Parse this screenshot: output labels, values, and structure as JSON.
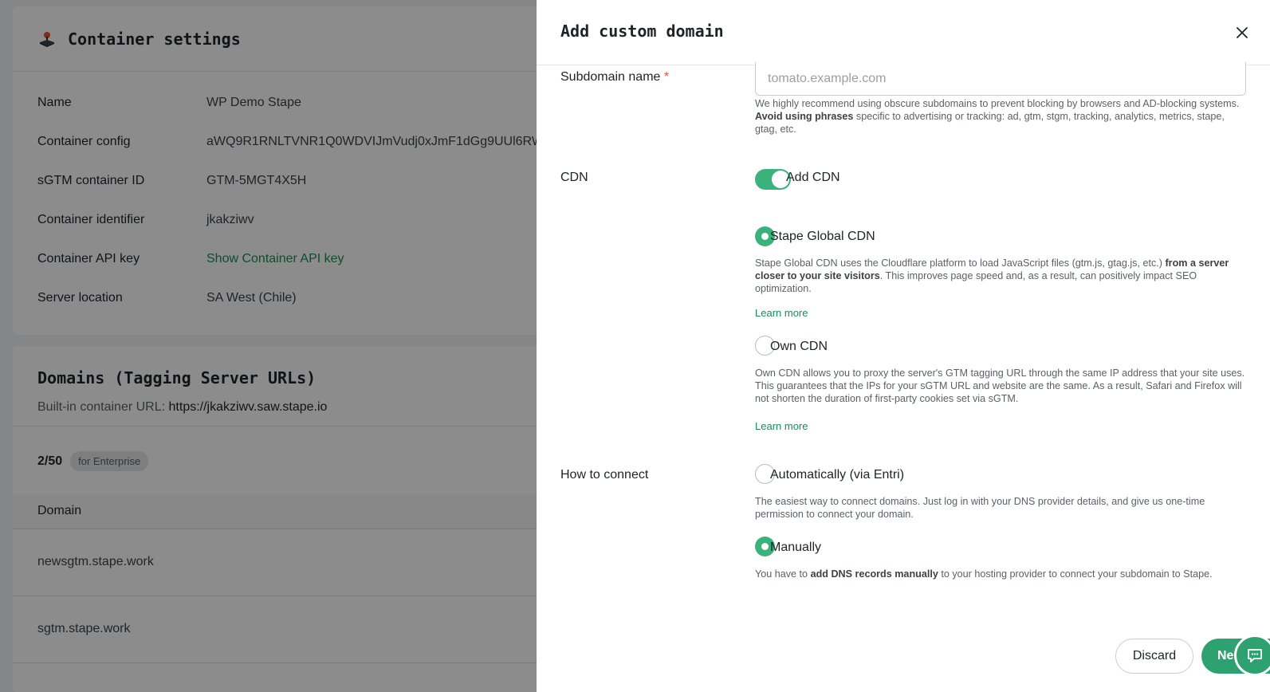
{
  "background": {
    "settings_title": "Container settings",
    "fields": [
      {
        "label": "Name",
        "value": "WP Demo Stape"
      },
      {
        "label": "Container config",
        "value": "aWQ9R1RNLTVNR1Q0WDVIJmVudj0xJmF1dGg9UUl6RW"
      },
      {
        "label": "sGTM container ID",
        "value": "GTM-5MGT4X5H"
      },
      {
        "label": "Container identifier",
        "value": "jkakziwv"
      },
      {
        "label": "Container API key",
        "value": "Show Container API key"
      },
      {
        "label": "Server location",
        "value": "SA West (Chile)"
      }
    ],
    "domains_title": "Domains (Tagging Server URLs)",
    "builtin_label": "Built-in container URL:",
    "builtin_url": "https://jkakziwv.saw.stape.io",
    "count": "2/50",
    "plan_badge": "for Enterprise",
    "domain_header": "Domain",
    "domains": [
      "newsgtm.stape.work",
      "sgtm.stape.work"
    ]
  },
  "drawer": {
    "title": "Add custom domain",
    "subdomain_label": "Subdomain name",
    "required_mark": "*",
    "subdomain_placeholder": "tomato.example.com",
    "subdomain_help_1": "We highly recommend using obscure subdomains to prevent blocking by browsers and AD-blocking systems.",
    "subdomain_help_bold": "Avoid using phrases",
    "subdomain_help_2": "specific to advertising or tracking: ad, gtm, stgm, tracking, analytics, metrics, stape, gtag, etc.",
    "cdn_label": "CDN",
    "add_cdn_label": "Add CDN",
    "add_cdn_on": true,
    "stape_cdn_label": "Stape Global CDN",
    "stape_cdn_help_1": "Stape Global CDN uses the Cloudflare platform to load JavaScript files (gtm.js, gtag.js, etc.)",
    "stape_cdn_help_bold": "from a server closer to your site visitors",
    "stape_cdn_help_2": ". This improves page speed and, as a result, can positively impact SEO optimization.",
    "learn_more_1": "Learn more",
    "own_cdn_label": "Own CDN",
    "own_cdn_help": "Own CDN allows you to proxy the server's GTM tagging URL through the same IP address that your site uses. This guarantees that the IPs for your sGTM URL and website are the same. As a result, Safari and Firefox will not shorten the duration of first-party cookies set via sGTM.",
    "learn_more_2": "Learn more",
    "connect_label": "How to connect",
    "auto_label": "Automatically (via Entri)",
    "auto_help": "The easiest way to connect domains. Just log in with your DNS provider details, and give us one-time permission to connect your domain.",
    "manual_label": "Manually",
    "manual_help_1": "You have to",
    "manual_help_bold": "add DNS records manually",
    "manual_help_2": "to your hosting provider to connect your subdomain to Stape.",
    "discard_label": "Discard",
    "next_label": "Ne"
  },
  "colors": {
    "accent": "#3bb27c",
    "accent_dark": "#2ea170",
    "link": "#1b8a5f",
    "overlay": "rgba(0,0,0,0.45)"
  },
  "icons": {
    "logo": "joystick-icon",
    "close": "close-icon",
    "chat": "chat-icon"
  }
}
